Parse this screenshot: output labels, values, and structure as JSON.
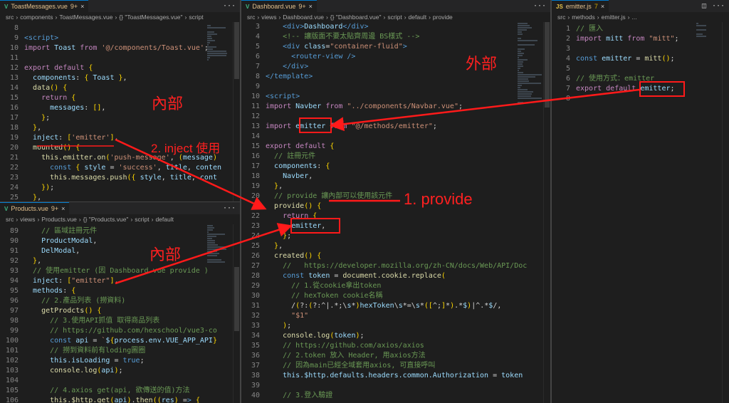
{
  "panes": {
    "toast": {
      "tab": {
        "icon": "V",
        "title": "ToastMessages.vue",
        "modified": "9+"
      },
      "breadcrumbs": [
        "src",
        "components",
        "ToastMessages.vue",
        "{} \"ToastMessages.vue\"",
        "script"
      ],
      "lines": [
        {
          "n": "8",
          "t": ""
        },
        {
          "n": "9",
          "t": "<script>"
        },
        {
          "n": "10",
          "t": "import Toast from '@/components/Toast.vue';"
        },
        {
          "n": "11",
          "t": ""
        },
        {
          "n": "12",
          "t": "export default {"
        },
        {
          "n": "13",
          "t": "  components: { Toast },"
        },
        {
          "n": "14",
          "t": "  data() {"
        },
        {
          "n": "15",
          "t": "    return {"
        },
        {
          "n": "16",
          "t": "      messages: [],"
        },
        {
          "n": "17",
          "t": "    };"
        },
        {
          "n": "18",
          "t": "  },"
        },
        {
          "n": "19",
          "t": "  inject: ['emitter'],"
        },
        {
          "n": "20",
          "t": "  mounted() {"
        },
        {
          "n": "21",
          "t": "    this.emitter.on('push-message', (message)"
        },
        {
          "n": "22",
          "t": "      const { style = 'success', title, conten"
        },
        {
          "n": "23",
          "t": "      this.messages.push({ style, title, cont"
        },
        {
          "n": "24",
          "t": "    });"
        },
        {
          "n": "25",
          "t": "  },"
        }
      ]
    },
    "products": {
      "tab": {
        "icon": "V",
        "title": "Products.vue",
        "modified": "9+"
      },
      "breadcrumbs": [
        "src",
        "views",
        "Products.vue",
        "{} \"Products.vue\"",
        "script",
        "default"
      ],
      "lines": [
        {
          "n": "89",
          "t": "    // 區域註冊元件"
        },
        {
          "n": "90",
          "t": "    ProductModal,"
        },
        {
          "n": "91",
          "t": "    DelModal,"
        },
        {
          "n": "92",
          "t": "  },"
        },
        {
          "n": "93",
          "t": "  // 使用emitter (因 Dashboard.vue provide )"
        },
        {
          "n": "94",
          "t": "  inject: [\"emitter\"],"
        },
        {
          "n": "95",
          "t": "  methods: {"
        },
        {
          "n": "96",
          "t": "    // 2.產品列表 (撈資料)"
        },
        {
          "n": "97",
          "t": "    getProdcts() {"
        },
        {
          "n": "98",
          "t": "      // 3.使用API抓值 取得商品列表"
        },
        {
          "n": "99",
          "t": "      // https://github.com/hexschool/vue3-co"
        },
        {
          "n": "100",
          "t": "      const api = `${process.env.VUE_APP_API}"
        },
        {
          "n": "101",
          "t": "      // 撈到資料前有loding圖圈"
        },
        {
          "n": "102",
          "t": "      this.isLoading = true;"
        },
        {
          "n": "103",
          "t": "      console.log(api);"
        },
        {
          "n": "104",
          "t": ""
        },
        {
          "n": "105",
          "t": "      // 4.axios get(api, 欲傳送的值)方法"
        },
        {
          "n": "106",
          "t": "      this.$http.get(api).then((res) => {"
        }
      ]
    },
    "dashboard": {
      "tab": {
        "icon": "V",
        "title": "Dashboard.vue",
        "modified": "9+"
      },
      "breadcrumbs": [
        "src",
        "views",
        "Dashboard.vue",
        "{} \"Dashboard.vue\"",
        "script",
        "default",
        "provide"
      ],
      "lines": [
        {
          "n": "3",
          "t": "    <div>Dashboard</div>"
        },
        {
          "n": "4",
          "t": "    <!-- 讓版面不要太貼齊周邊 BS樣式 -->"
        },
        {
          "n": "5",
          "t": "    <div class=\"container-fluid\">"
        },
        {
          "n": "6",
          "t": "      <router-view />"
        },
        {
          "n": "7",
          "t": "    </div>"
        },
        {
          "n": "8",
          "t": "</template>"
        },
        {
          "n": "9",
          "t": ""
        },
        {
          "n": "10",
          "t": "<script>"
        },
        {
          "n": "11",
          "t": "import Navber from \"../components/Navbar.vue\";"
        },
        {
          "n": "12",
          "t": ""
        },
        {
          "n": "13",
          "t": "import emitter from \"@/methods/emitter\";"
        },
        {
          "n": "14",
          "t": ""
        },
        {
          "n": "15",
          "t": "export default {"
        },
        {
          "n": "16",
          "t": "  // 註冊元件"
        },
        {
          "n": "17",
          "t": "  components: {"
        },
        {
          "n": "18",
          "t": "    Navber,"
        },
        {
          "n": "19",
          "t": "  },"
        },
        {
          "n": "20",
          "t": "  // provide 讓內部可以使用該元件"
        },
        {
          "n": "21",
          "t": "  provide() {"
        },
        {
          "n": "22",
          "t": "    return {"
        },
        {
          "n": "23",
          "t": "      emitter,"
        },
        {
          "n": "24",
          "t": "    };"
        },
        {
          "n": "25",
          "t": "  },"
        },
        {
          "n": "26",
          "t": "  created() {"
        },
        {
          "n": "27",
          "t": "    //   https://developer.mozilla.org/zh-CN/docs/Web/API/Doc"
        },
        {
          "n": "28",
          "t": "    const token = document.cookie.replace("
        },
        {
          "n": "29",
          "t": "      // 1.從cookie拿出token"
        },
        {
          "n": "30",
          "t": "      // hexToken cookie名稱"
        },
        {
          "n": "31",
          "t": "      /(?:(?:^|.*;\\s*)hexToken\\s*=\\s*([^;]*).*$)|^.*$/,"
        },
        {
          "n": "32",
          "t": "      \"$1\""
        },
        {
          "n": "33",
          "t": "    );"
        },
        {
          "n": "34",
          "t": "    console.log(token);"
        },
        {
          "n": "35",
          "t": "    // https://github.com/axios/axios"
        },
        {
          "n": "36",
          "t": "    // 2.token 放入 Header, 用axios方法"
        },
        {
          "n": "37",
          "t": "    // 因為main已經全域套用axios, 可直接呼叫"
        },
        {
          "n": "38",
          "t": "    this.$http.defaults.headers.common.Authorization = token"
        },
        {
          "n": "39",
          "t": ""
        },
        {
          "n": "40",
          "t": "    // 3.登入驗證"
        }
      ]
    },
    "emitter": {
      "tab": {
        "icon": "JS",
        "title": "emitter.js",
        "modified": "7"
      },
      "breadcrumbs": [
        "src",
        "methods",
        "emitter.js",
        "..."
      ],
      "lines": [
        {
          "n": "1",
          "t": "// 匯入"
        },
        {
          "n": "2",
          "t": "import mitt from \"mitt\";"
        },
        {
          "n": "3",
          "t": ""
        },
        {
          "n": "4",
          "t": "const emitter = mitt();"
        },
        {
          "n": "5",
          "t": ""
        },
        {
          "n": "6",
          "t": "// 使用方式：emitter"
        },
        {
          "n": "7",
          "t": "export default emitter;"
        },
        {
          "n": "8",
          "t": ""
        }
      ]
    }
  },
  "annotations": {
    "outside": "外部",
    "inside_top": "內部",
    "inside_bottom": "內部",
    "inject_use": "2. inject 使用",
    "provide": "1. provide"
  },
  "colors": {
    "annotation": "#ff1a1a",
    "editor_bg": "#1e1e1e",
    "tabbar_bg": "#252526"
  }
}
